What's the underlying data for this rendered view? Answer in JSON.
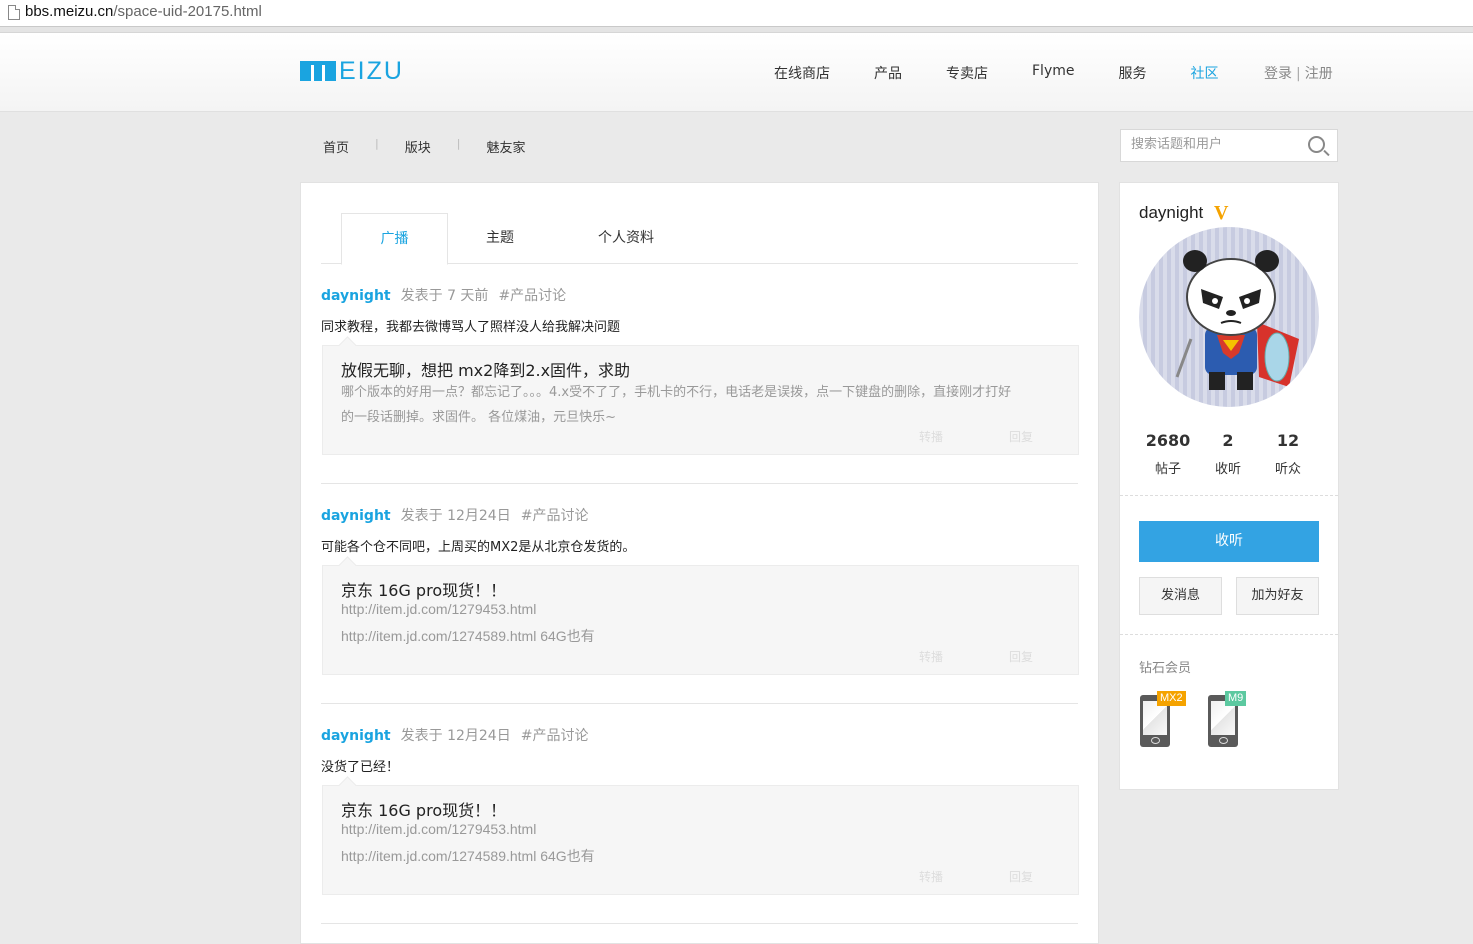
{
  "browser": {
    "url_host": "bbs.meizu.cn",
    "url_path": "/space-uid-20175.html"
  },
  "header": {
    "logo_text": "EIZU",
    "nav": [
      "在线商店",
      "产品",
      "专卖店",
      "Flyme",
      "服务",
      "社区"
    ],
    "active_nav": "社区",
    "login": "登录",
    "register": "注册",
    "login_sep": "|"
  },
  "subnav": {
    "items": [
      "首页",
      "版块",
      "魅友家"
    ],
    "sep": "|"
  },
  "search": {
    "placeholder": "搜索话题和用户"
  },
  "tabs": [
    "广播",
    "主题",
    "个人资料"
  ],
  "posts": [
    {
      "user": "daynight",
      "time": "发表于 7 天前",
      "topic": "#产品讨论",
      "text": "同求教程，我都去微博骂人了照样没人给我解决问题",
      "quote_title": "放假无聊，想把 mx2降到2.x固件，求助",
      "quote_lines": [
        "哪个版本的好用一点？都忘记了。。。4.x受不了了，手机卡的不行，电话老是误拨，点一下键盘的删除，直接刚才打好",
        "的一段话删掉。求固件。 各位煤油，元旦快乐~"
      ],
      "forward": "转播",
      "reply": "回复"
    },
    {
      "user": "daynight",
      "time": "发表于 12月24日",
      "topic": "#产品讨论",
      "text": "可能各个仓不同吧，上周买的MX2是从北京仓发货的。",
      "quote_title": "京东 16G pro现货！！",
      "quote_lines": [
        "http://item.jd.com/1279453.html",
        "http://item.jd.com/1274589.html 64G也有"
      ],
      "forward": "转播",
      "reply": "回复"
    },
    {
      "user": "daynight",
      "time": "发表于 12月24日",
      "topic": "#产品讨论",
      "text": "没货了已经！",
      "quote_title": "京东 16G pro现货！！",
      "quote_lines": [
        "http://item.jd.com/1279453.html",
        "http://item.jd.com/1274589.html 64G也有"
      ],
      "forward": "转播",
      "reply": "回复"
    }
  ],
  "profile": {
    "username": "daynight",
    "badge": "V",
    "stats": [
      {
        "num": "2680",
        "label": "帖子"
      },
      {
        "num": "2",
        "label": "收听"
      },
      {
        "num": "12",
        "label": "听众"
      }
    ],
    "follow_label": "收听",
    "message_label": "发消息",
    "add_friend_label": "加为好友",
    "level_label": "钻石会员",
    "devices": [
      {
        "tag": "MX2",
        "color": "#f5a300"
      },
      {
        "tag": "M9",
        "color": "#5cc9a0"
      }
    ]
  },
  "colors": {
    "accent": "#1aa4e0",
    "button": "#33a3e3"
  }
}
